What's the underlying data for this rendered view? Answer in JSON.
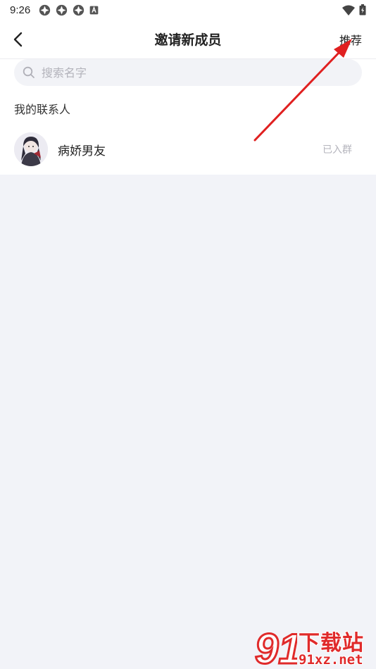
{
  "status_bar": {
    "time": "9:26",
    "notification_icons": [
      "app-notification-icon",
      "app-notification-icon",
      "app-notification-icon",
      "a-notification-icon"
    ],
    "right_icons": [
      "wifi-icon",
      "battery-icon"
    ]
  },
  "nav": {
    "title": "邀请新成员",
    "recommend_label": "推荐"
  },
  "search": {
    "placeholder": "搜索名字",
    "value": ""
  },
  "contacts": {
    "section_title": "我的联系人",
    "items": [
      {
        "name": "病娇男友",
        "status": "已入群"
      }
    ]
  },
  "watermark": {
    "logo_text": "91",
    "title": "下载站",
    "url": "91xz.net"
  },
  "colors": {
    "background": "#f2f3f8",
    "surface": "#ffffff",
    "annotation_arrow": "#e02020",
    "watermark_red": "#e02a2a"
  }
}
